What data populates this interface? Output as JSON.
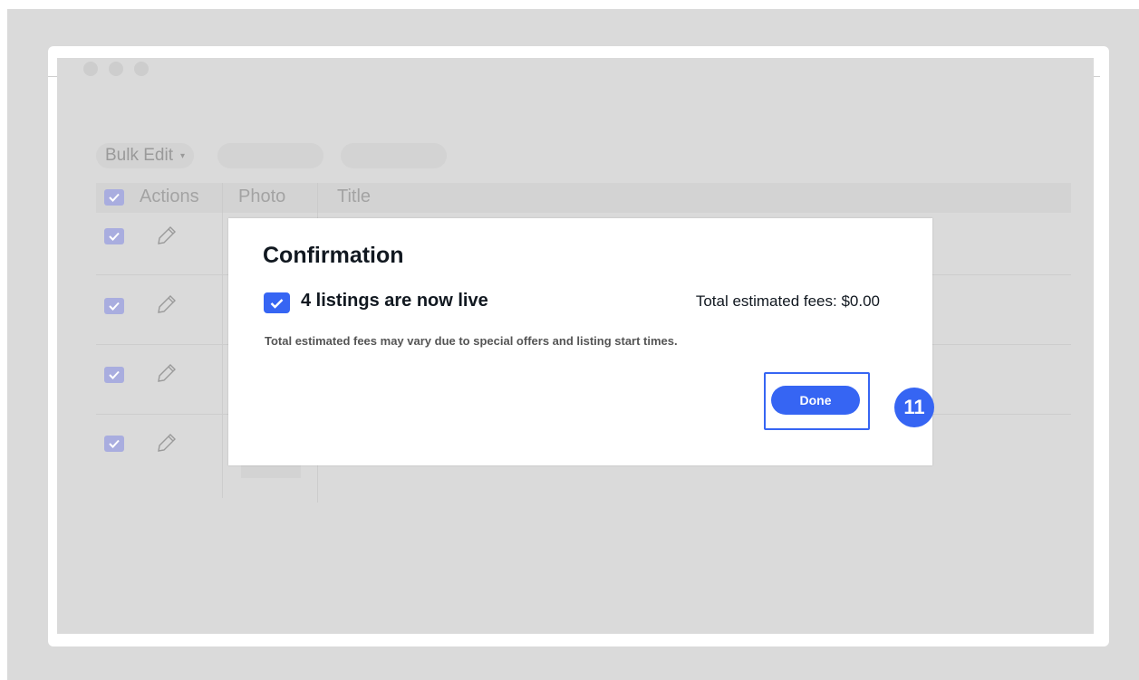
{
  "toolbar": {
    "bulk_edit_label": "Bulk Edit",
    "caret": "▾"
  },
  "table": {
    "columns": [
      "Actions",
      "Photo",
      "Title"
    ],
    "rows": 4
  },
  "modal": {
    "title": "Confirmation",
    "live_message": "4 listings are now live",
    "fees": "Total estimated fees: $0.00",
    "note": "Total estimated fees may vary due to special offers and listing start times.",
    "done_label": "Done"
  },
  "step_badge": "11",
  "colors": {
    "accent": "#3665f3",
    "overlay": "#dadada",
    "dim_checkbox": "#a9addf"
  }
}
